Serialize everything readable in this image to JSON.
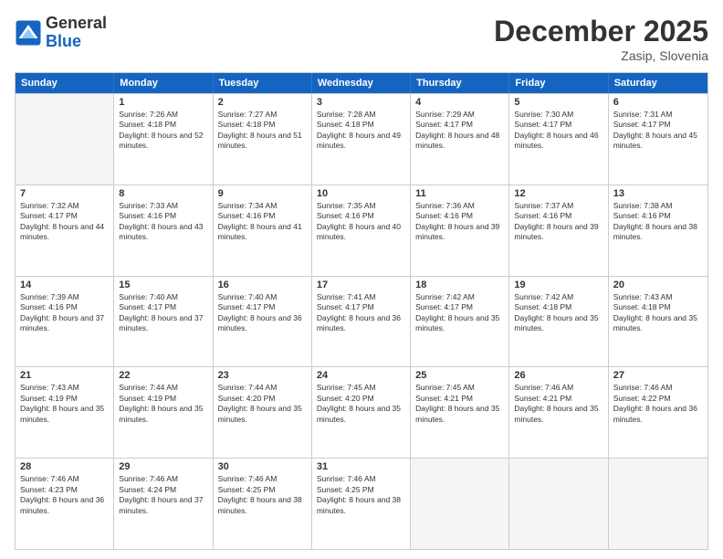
{
  "header": {
    "logo": {
      "general": "General",
      "blue": "Blue"
    },
    "month": "December 2025",
    "location": "Zasip, Slovenia"
  },
  "weekdays": [
    "Sunday",
    "Monday",
    "Tuesday",
    "Wednesday",
    "Thursday",
    "Friday",
    "Saturday"
  ],
  "rows": [
    [
      {
        "day": "",
        "empty": true
      },
      {
        "day": "1",
        "sunrise": "Sunrise: 7:26 AM",
        "sunset": "Sunset: 4:18 PM",
        "daylight": "Daylight: 8 hours and 52 minutes."
      },
      {
        "day": "2",
        "sunrise": "Sunrise: 7:27 AM",
        "sunset": "Sunset: 4:18 PM",
        "daylight": "Daylight: 8 hours and 51 minutes."
      },
      {
        "day": "3",
        "sunrise": "Sunrise: 7:28 AM",
        "sunset": "Sunset: 4:18 PM",
        "daylight": "Daylight: 8 hours and 49 minutes."
      },
      {
        "day": "4",
        "sunrise": "Sunrise: 7:29 AM",
        "sunset": "Sunset: 4:17 PM",
        "daylight": "Daylight: 8 hours and 48 minutes."
      },
      {
        "day": "5",
        "sunrise": "Sunrise: 7:30 AM",
        "sunset": "Sunset: 4:17 PM",
        "daylight": "Daylight: 8 hours and 46 minutes."
      },
      {
        "day": "6",
        "sunrise": "Sunrise: 7:31 AM",
        "sunset": "Sunset: 4:17 PM",
        "daylight": "Daylight: 8 hours and 45 minutes."
      }
    ],
    [
      {
        "day": "7",
        "sunrise": "Sunrise: 7:32 AM",
        "sunset": "Sunset: 4:17 PM",
        "daylight": "Daylight: 8 hours and 44 minutes."
      },
      {
        "day": "8",
        "sunrise": "Sunrise: 7:33 AM",
        "sunset": "Sunset: 4:16 PM",
        "daylight": "Daylight: 8 hours and 43 minutes."
      },
      {
        "day": "9",
        "sunrise": "Sunrise: 7:34 AM",
        "sunset": "Sunset: 4:16 PM",
        "daylight": "Daylight: 8 hours and 41 minutes."
      },
      {
        "day": "10",
        "sunrise": "Sunrise: 7:35 AM",
        "sunset": "Sunset: 4:16 PM",
        "daylight": "Daylight: 8 hours and 40 minutes."
      },
      {
        "day": "11",
        "sunrise": "Sunrise: 7:36 AM",
        "sunset": "Sunset: 4:16 PM",
        "daylight": "Daylight: 8 hours and 39 minutes."
      },
      {
        "day": "12",
        "sunrise": "Sunrise: 7:37 AM",
        "sunset": "Sunset: 4:16 PM",
        "daylight": "Daylight: 8 hours and 39 minutes."
      },
      {
        "day": "13",
        "sunrise": "Sunrise: 7:38 AM",
        "sunset": "Sunset: 4:16 PM",
        "daylight": "Daylight: 8 hours and 38 minutes."
      }
    ],
    [
      {
        "day": "14",
        "sunrise": "Sunrise: 7:39 AM",
        "sunset": "Sunset: 4:16 PM",
        "daylight": "Daylight: 8 hours and 37 minutes."
      },
      {
        "day": "15",
        "sunrise": "Sunrise: 7:40 AM",
        "sunset": "Sunset: 4:17 PM",
        "daylight": "Daylight: 8 hours and 37 minutes."
      },
      {
        "day": "16",
        "sunrise": "Sunrise: 7:40 AM",
        "sunset": "Sunset: 4:17 PM",
        "daylight": "Daylight: 8 hours and 36 minutes."
      },
      {
        "day": "17",
        "sunrise": "Sunrise: 7:41 AM",
        "sunset": "Sunset: 4:17 PM",
        "daylight": "Daylight: 8 hours and 36 minutes."
      },
      {
        "day": "18",
        "sunrise": "Sunrise: 7:42 AM",
        "sunset": "Sunset: 4:17 PM",
        "daylight": "Daylight: 8 hours and 35 minutes."
      },
      {
        "day": "19",
        "sunrise": "Sunrise: 7:42 AM",
        "sunset": "Sunset: 4:18 PM",
        "daylight": "Daylight: 8 hours and 35 minutes."
      },
      {
        "day": "20",
        "sunrise": "Sunrise: 7:43 AM",
        "sunset": "Sunset: 4:18 PM",
        "daylight": "Daylight: 8 hours and 35 minutes."
      }
    ],
    [
      {
        "day": "21",
        "sunrise": "Sunrise: 7:43 AM",
        "sunset": "Sunset: 4:19 PM",
        "daylight": "Daylight: 8 hours and 35 minutes."
      },
      {
        "day": "22",
        "sunrise": "Sunrise: 7:44 AM",
        "sunset": "Sunset: 4:19 PM",
        "daylight": "Daylight: 8 hours and 35 minutes."
      },
      {
        "day": "23",
        "sunrise": "Sunrise: 7:44 AM",
        "sunset": "Sunset: 4:20 PM",
        "daylight": "Daylight: 8 hours and 35 minutes."
      },
      {
        "day": "24",
        "sunrise": "Sunrise: 7:45 AM",
        "sunset": "Sunset: 4:20 PM",
        "daylight": "Daylight: 8 hours and 35 minutes."
      },
      {
        "day": "25",
        "sunrise": "Sunrise: 7:45 AM",
        "sunset": "Sunset: 4:21 PM",
        "daylight": "Daylight: 8 hours and 35 minutes."
      },
      {
        "day": "26",
        "sunrise": "Sunrise: 7:46 AM",
        "sunset": "Sunset: 4:21 PM",
        "daylight": "Daylight: 8 hours and 35 minutes."
      },
      {
        "day": "27",
        "sunrise": "Sunrise: 7:46 AM",
        "sunset": "Sunset: 4:22 PM",
        "daylight": "Daylight: 8 hours and 36 minutes."
      }
    ],
    [
      {
        "day": "28",
        "sunrise": "Sunrise: 7:46 AM",
        "sunset": "Sunset: 4:23 PM",
        "daylight": "Daylight: 8 hours and 36 minutes."
      },
      {
        "day": "29",
        "sunrise": "Sunrise: 7:46 AM",
        "sunset": "Sunset: 4:24 PM",
        "daylight": "Daylight: 8 hours and 37 minutes."
      },
      {
        "day": "30",
        "sunrise": "Sunrise: 7:46 AM",
        "sunset": "Sunset: 4:25 PM",
        "daylight": "Daylight: 8 hours and 38 minutes."
      },
      {
        "day": "31",
        "sunrise": "Sunrise: 7:46 AM",
        "sunset": "Sunset: 4:25 PM",
        "daylight": "Daylight: 8 hours and 38 minutes."
      },
      {
        "day": "",
        "empty": true
      },
      {
        "day": "",
        "empty": true
      },
      {
        "day": "",
        "empty": true
      }
    ]
  ]
}
